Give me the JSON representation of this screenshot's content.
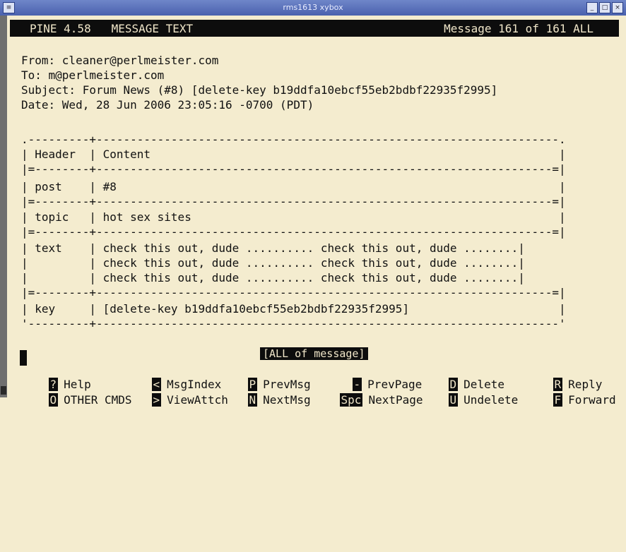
{
  "window": {
    "title": "rms1613 xybox",
    "menu_glyph": "≡",
    "minimize_glyph": "_",
    "maximize_glyph": "□",
    "close_glyph": "×"
  },
  "pine_header": {
    "left": "PINE 4.58   MESSAGE TEXT",
    "right": "Message 161 of 161 ALL"
  },
  "headers": {
    "from": "From: cleaner@perlmeister.com",
    "to": "To: m@perlmeister.com",
    "subject": "Subject: Forum News (#8) [delete-key b19ddfa10ebcf55eb2bdbf22935f2995]",
    "date": "Date: Wed, 28 Jun 2006 23:05:16 -0700 (PDT)"
  },
  "table": [
    ".---------+--------------------------------------------------------------------.",
    "| Header  | Content                                                            |",
    "|=--------+-------------------------------------------------------------------=|",
    "| post    | #8                                                                 |",
    "|=--------+-------------------------------------------------------------------=|",
    "| topic   | hot sex sites                                                      |",
    "|=--------+-------------------------------------------------------------------=|",
    "| text    | check this out, dude .......... check this out, dude ........|",
    "|         | check this out, dude .......... check this out, dude ........|",
    "|         | check this out, dude .......... check this out, dude ........|",
    "|=--------+-------------------------------------------------------------------=|",
    "| key     | [delete-key b19ddfa10ebcf55eb2bdbf22935f2995]                      |",
    "'---------+--------------------------------------------------------------------'"
  ],
  "status": "[ALL of message]",
  "commands": {
    "help": {
      "key": "?",
      "label": "Help"
    },
    "other": {
      "key": "O",
      "label": "OTHER CMDS"
    },
    "msgindex": {
      "key": "<",
      "label": "MsgIndex"
    },
    "viewattch": {
      "key": ">",
      "label": "ViewAttch"
    },
    "prevmsg": {
      "key": "P",
      "label": "PrevMsg"
    },
    "nextmsg": {
      "key": "N",
      "label": "NextMsg"
    },
    "prevpage": {
      "key": "-",
      "label": "PrevPage"
    },
    "nextpage": {
      "key": "Spc",
      "label": "NextPage"
    },
    "delete": {
      "key": "D",
      "label": "Delete"
    },
    "undelete": {
      "key": "U",
      "label": "Undelete"
    },
    "reply": {
      "key": "R",
      "label": "Reply"
    },
    "forward": {
      "key": "F",
      "label": "Forward"
    }
  }
}
